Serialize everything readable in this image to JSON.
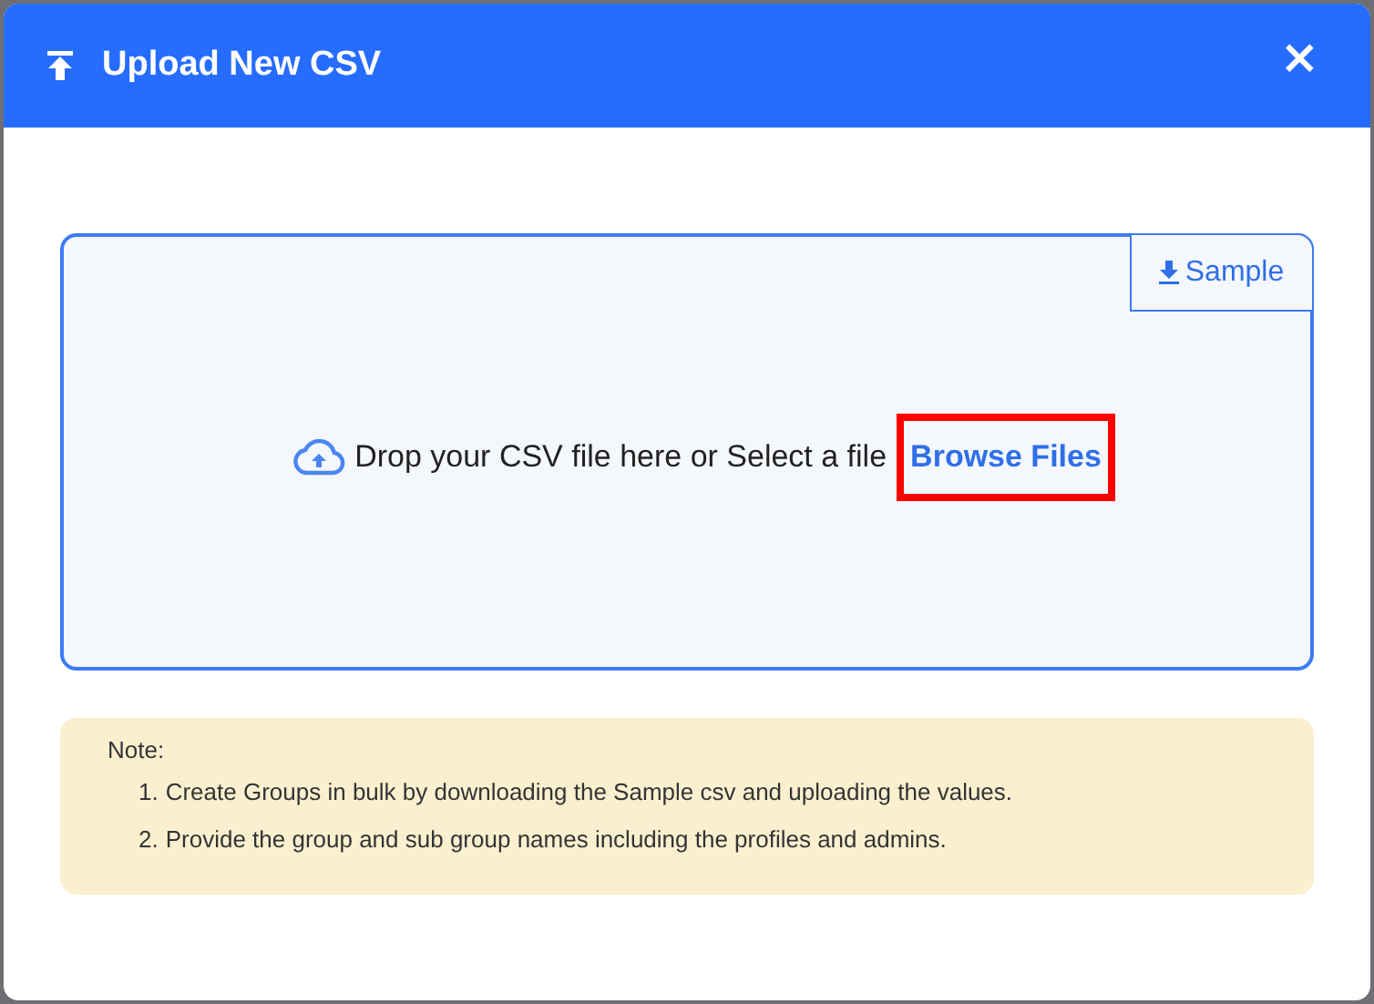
{
  "dialog": {
    "title": "Upload New CSV",
    "close": "×"
  },
  "dropzone": {
    "sample_button": "Sample",
    "prompt": "Drop your CSV file here or Select a file",
    "browse_link": {
      "label": "Browse Files",
      "highlighted": true
    }
  },
  "note": {
    "heading": "Note:",
    "items": [
      {
        "number": "1.",
        "text": "Create Groups in bulk by downloading the Sample csv and uploading the values."
      },
      {
        "number": "2.",
        "text": "Provide the group and sub group names including the profiles and admins."
      }
    ]
  }
}
